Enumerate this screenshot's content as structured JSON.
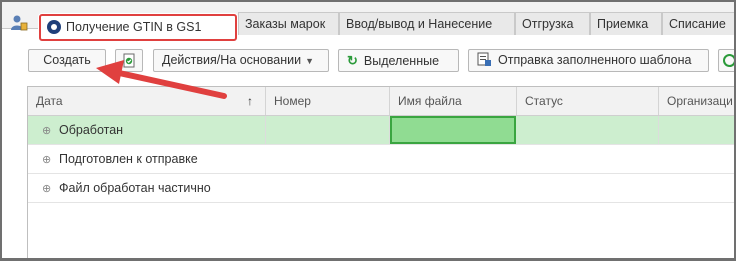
{
  "tabs": [
    {
      "label": "Получение GTIN в GS1",
      "active": true
    },
    {
      "label": "Заказы марок"
    },
    {
      "label": "Ввод/вывод и Нанесение"
    },
    {
      "label": "Отгрузка"
    },
    {
      "label": "Приемка"
    },
    {
      "label": "Списание"
    }
  ],
  "toolbar": {
    "create_label": "Создать",
    "actions_label": "Действия/На основании",
    "selected_label": "Выделенные",
    "send_template_label": "Отправка заполненного шаблона"
  },
  "grid": {
    "columns": [
      "Дата",
      "Номер",
      "Имя файла",
      "Статус",
      "Организаци"
    ],
    "sort_indicator": "↑",
    "rows": [
      {
        "label": "Обработан",
        "selected": true
      },
      {
        "label": "Подготовлен к отправке"
      },
      {
        "label": "Файл обработан частично"
      }
    ]
  },
  "colors": {
    "highlight": "#e0403f",
    "selected_row": "#cdeecf",
    "focused_cell": "#90dc92",
    "accent_green": "#2b9a3a"
  }
}
